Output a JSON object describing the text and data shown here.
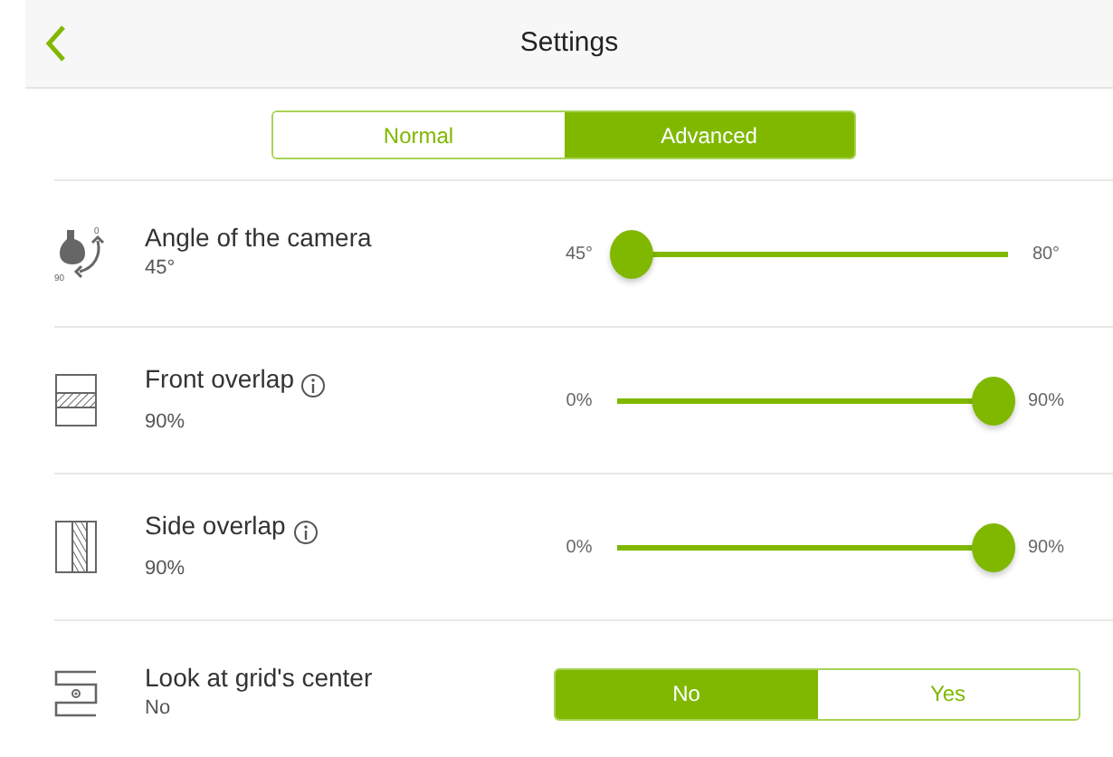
{
  "header": {
    "title": "Settings"
  },
  "mode_tabs": [
    {
      "label": "Normal",
      "selected": false
    },
    {
      "label": "Advanced",
      "selected": true
    }
  ],
  "settings": [
    {
      "kind": "slider",
      "title": "Angle of the camera",
      "info": false,
      "value": "45°",
      "icon_labels": [
        "0",
        "90"
      ],
      "min_label": "45°",
      "max_label": "80°",
      "level": 0
    },
    {
      "kind": "slider",
      "title": "Front overlap",
      "info": true,
      "value": "90%",
      "min_label": "0%",
      "max_label": "90%",
      "level": 1
    },
    {
      "kind": "slider",
      "title": "Side overlap",
      "info": true,
      "value": "90%",
      "min_label": "0%",
      "max_label": "90%",
      "level": 1
    },
    {
      "kind": "toggle",
      "title": "Look at grid's center",
      "info": false,
      "value": "No",
      "options": [
        {
          "label": "No",
          "selected": true
        },
        {
          "label": "Yes",
          "selected": false
        }
      ]
    }
  ]
}
